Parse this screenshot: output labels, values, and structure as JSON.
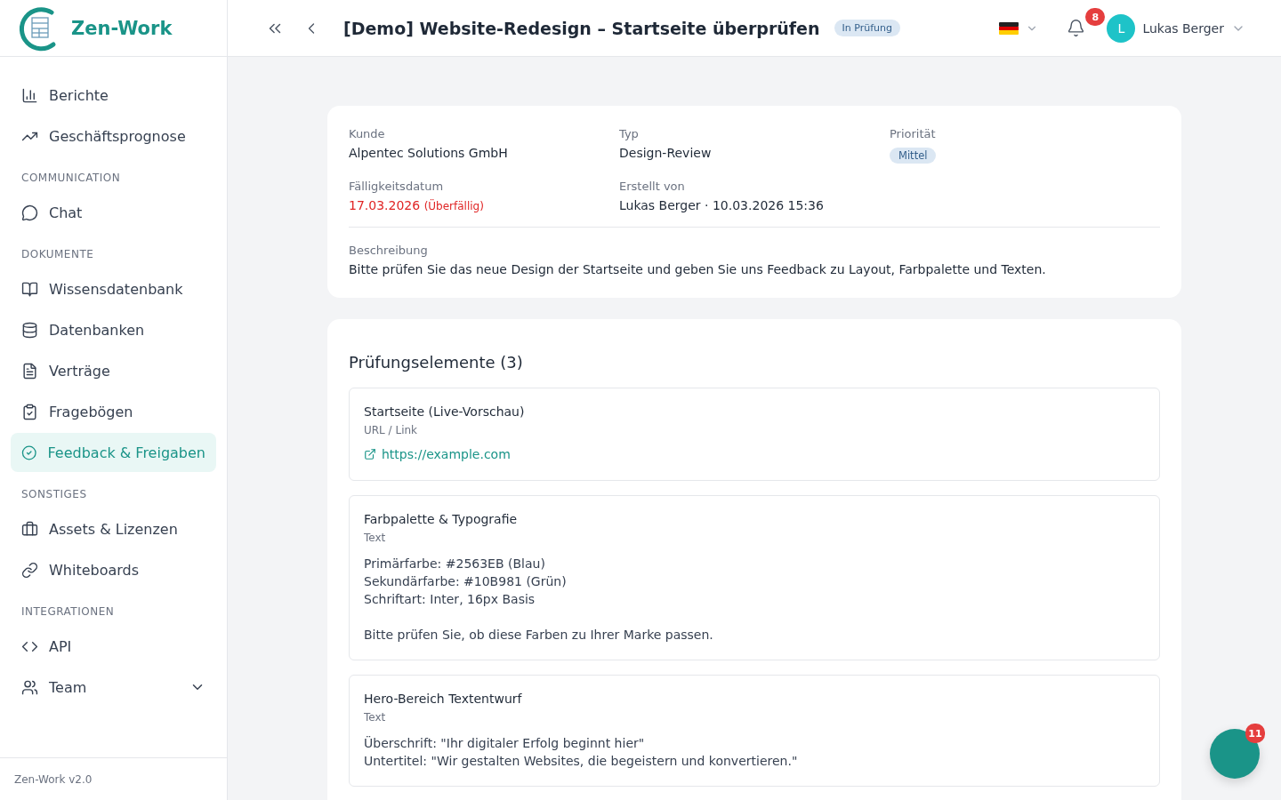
{
  "brand": {
    "name": "Zen-Work",
    "version": "Zen-Work v2.0"
  },
  "sidebar": {
    "sections": [
      {
        "items": [
          {
            "label": "Berichte",
            "selected": false
          },
          {
            "label": "Geschäftsprognose",
            "selected": false
          }
        ]
      },
      {
        "title": "COMMUNICATION",
        "items": [
          {
            "label": "Chat",
            "selected": false
          }
        ]
      },
      {
        "title": "DOKUMENTE",
        "items": [
          {
            "label": "Wissensdatenbank",
            "selected": false
          },
          {
            "label": "Datenbanken",
            "selected": false
          },
          {
            "label": "Verträge",
            "selected": false
          },
          {
            "label": "Fragebögen",
            "selected": false
          },
          {
            "label": "Feedback & Freigaben",
            "selected": true
          }
        ]
      },
      {
        "title": "SONSTIGES",
        "items": [
          {
            "label": "Assets & Lizenzen",
            "selected": false
          },
          {
            "label": "Whiteboards",
            "selected": false
          }
        ]
      },
      {
        "title": "INTEGRATIONEN",
        "items": [
          {
            "label": "API",
            "selected": false
          },
          {
            "label": "Team",
            "selected": false,
            "expandable": true
          }
        ]
      }
    ]
  },
  "header": {
    "title": "[Demo] Website-Redesign – Startseite überprüfen",
    "status": "In Prüfung",
    "notifications": "8",
    "user": {
      "initial": "L",
      "name": "Lukas Berger"
    }
  },
  "details": {
    "fields": [
      {
        "label": "Kunde",
        "value": "Alpentec Solutions GmbH",
        "kind": "text"
      },
      {
        "label": "Typ",
        "value": "Design-Review",
        "kind": "text"
      },
      {
        "label": "Priorität",
        "value": "Mittel",
        "kind": "badge"
      },
      {
        "label": "Fälligkeitsdatum",
        "value": "17.03.2026",
        "note": "(Überfällig)",
        "kind": "overdue"
      },
      {
        "label": "Erstellt von",
        "value": "Lukas Berger · 10.03.2026 15:36",
        "kind": "text"
      }
    ],
    "description": {
      "label": "Beschreibung",
      "text": "Bitte prüfen Sie das neue Design der Startseite und geben Sie uns Feedback zu Layout, Farbpalette und Texten."
    }
  },
  "review": {
    "title": "Prüfungselemente (3)",
    "items": [
      {
        "title": "Startseite (Live-Vorschau)",
        "type": "URL / Link",
        "kind": "link",
        "link": "https://example.com"
      },
      {
        "title": "Farbpalette & Typografie",
        "type": "Text",
        "kind": "text",
        "paragraphs": [
          [
            "Primärfarbe: #2563EB (Blau)",
            "Sekundärfarbe: #10B981 (Grün)",
            "Schriftart: Inter, 16px Basis"
          ],
          [
            "Bitte prüfen Sie, ob diese Farben zu Ihrer Marke passen."
          ]
        ]
      },
      {
        "title": "Hero-Bereich Textentwurf",
        "type": "Text",
        "kind": "text",
        "paragraphs": [
          [
            "Überschrift: \"Ihr digitaler Erfolg beginnt hier\"",
            "Untertitel: \"Wir gestalten Websites, die begeistern und konvertieren.\""
          ]
        ]
      }
    ]
  },
  "chat_badge": "11"
}
